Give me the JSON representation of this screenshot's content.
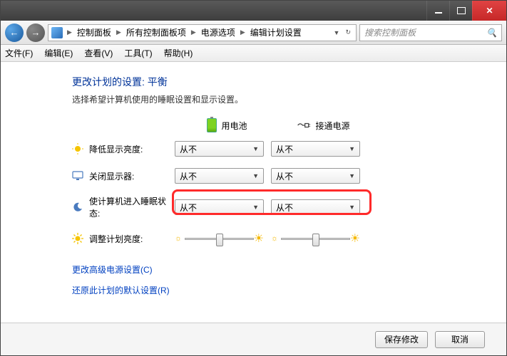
{
  "titlebar": {
    "min": "min",
    "max": "max",
    "close": "close"
  },
  "breadcrumbs": [
    "控制面板",
    "所有控制面板项",
    "电源选项",
    "编辑计划设置"
  ],
  "search": {
    "placeholder": "搜索控制面板"
  },
  "menu": {
    "file": "文件(F)",
    "edit": "编辑(E)",
    "view": "查看(V)",
    "tools": "工具(T)",
    "help": "帮助(H)"
  },
  "heading": "更改计划的设置: 平衡",
  "sub": "选择希望计算机使用的睡眠设置和显示设置。",
  "columns": {
    "battery": "用电池",
    "plugged": "接通电源"
  },
  "rows": {
    "dim": {
      "label": "降低显示亮度:",
      "battery": "从不",
      "plugged": "从不"
    },
    "off": {
      "label": "关闭显示器:",
      "battery": "从不",
      "plugged": "从不"
    },
    "sleep": {
      "label": "使计算机进入睡眠状态:",
      "battery": "从不",
      "plugged": "从不"
    },
    "brightness": {
      "label": "调整计划亮度:"
    }
  },
  "links": {
    "advanced": "更改高级电源设置(C)",
    "restore": "还原此计划的默认设置(R)"
  },
  "buttons": {
    "save": "保存修改",
    "cancel": "取消"
  }
}
